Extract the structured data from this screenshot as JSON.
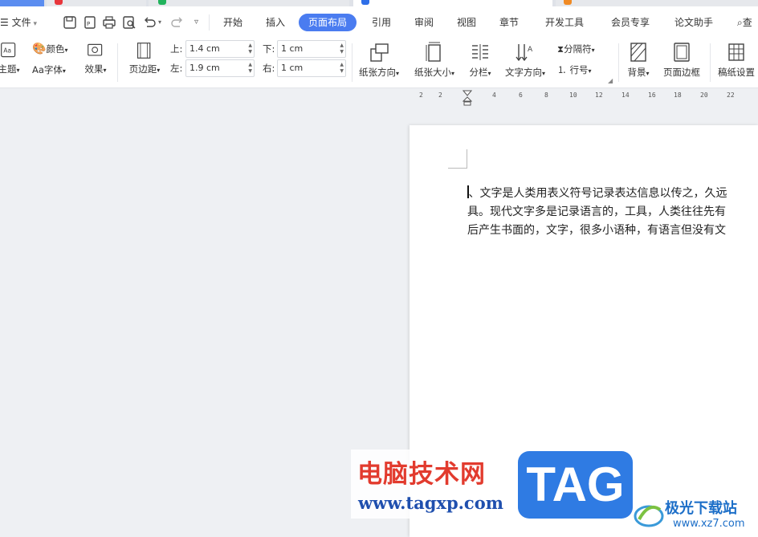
{
  "menu": {
    "file_label": "文件",
    "tabs": [
      "开始",
      "插入",
      "页面布局",
      "引用",
      "审阅",
      "视图",
      "章节",
      "开发工具",
      "会员专享",
      "论文助手"
    ],
    "active_tab": "页面布局",
    "search_label": "查"
  },
  "ribbon": {
    "theme_label": "主题",
    "color_label": "颜色",
    "font_label": "字体",
    "font_prefix": "Aa",
    "effect_label": "效果",
    "margins_label": "页边距",
    "top_label": "上:",
    "top_value": "1.4 cm",
    "bottom_label": "下:",
    "bottom_value": "1 cm",
    "left_label": "左:",
    "left_value": "1.9 cm",
    "right_label": "右:",
    "right_value": "1 cm",
    "orientation_label": "纸张方向",
    "size_label": "纸张大小",
    "columns_label": "分栏",
    "text_direction_label": "文字方向",
    "breaks_label": "分隔符",
    "line_numbers_label": "行号",
    "background_label": "背景",
    "page_border_label": "页面边框",
    "manuscript_label": "稿纸设置"
  },
  "ruler": {
    "ticks": [
      "2",
      "2",
      "4",
      "6",
      "8",
      "10",
      "12",
      "14",
      "16",
      "18",
      "20",
      "22"
    ]
  },
  "document": {
    "lines": [
      "、文字是人类用表义符号记录表达信息以传之，久远",
      "具。现代文字多是记录语言的，工具，人类往往先有",
      "后产生书面的，文字，很多小语种，有语言但没有文"
    ]
  },
  "watermarks": {
    "site_cn": "电脑技术网",
    "site_url": "www.tagxp.com",
    "tag": "TAG",
    "jg_cn": "极光下载站",
    "jg_url": "www.xz7.com"
  }
}
